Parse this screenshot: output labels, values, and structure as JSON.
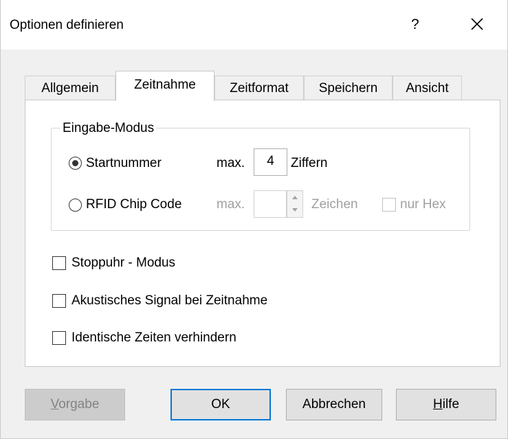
{
  "window": {
    "title": "Optionen definieren",
    "help_glyph": "?",
    "close_glyph": "✕"
  },
  "tabs": [
    {
      "label": "Allgemein",
      "active": false
    },
    {
      "label": "Zeitnahme",
      "active": true
    },
    {
      "label": "Zeitformat",
      "active": false
    },
    {
      "label": "Speichern",
      "active": false
    },
    {
      "label": "Ansicht",
      "active": false
    }
  ],
  "eingabe_modus": {
    "legend": "Eingabe-Modus",
    "startnummer": {
      "label": "Startnummer",
      "selected": true,
      "max_label": "max.",
      "max_value": "4",
      "unit": "Ziffern"
    },
    "rfid": {
      "label": "RFID Chip Code",
      "selected": false,
      "max_label": "max.",
      "max_value": "",
      "unit": "Zeichen",
      "hex_label": "nur Hex",
      "hex_checked": false
    }
  },
  "options": [
    {
      "label": "Stoppuhr - Modus",
      "checked": false
    },
    {
      "label": "Akustisches Signal bei Zeitnahme",
      "checked": false
    },
    {
      "label": "Identische Zeiten verhindern",
      "checked": false
    }
  ],
  "buttons": {
    "vorgabe_underline": "V",
    "vorgabe_rest": "orgabe",
    "ok": "OK",
    "abbrechen": "Abbrechen",
    "hilfe_underline": "H",
    "hilfe_rest": "ilfe"
  }
}
